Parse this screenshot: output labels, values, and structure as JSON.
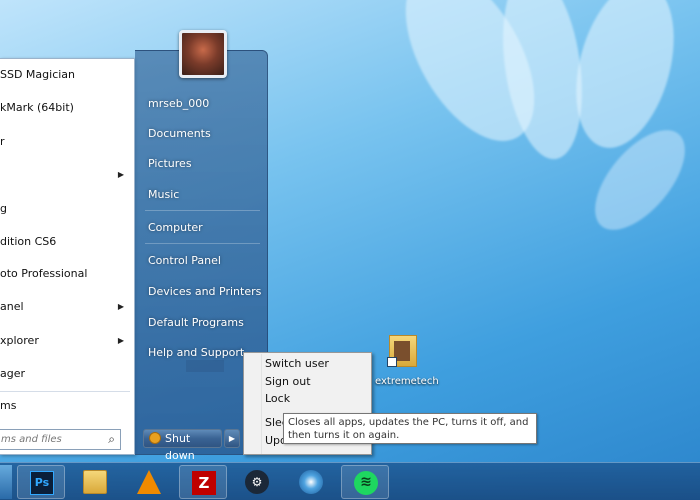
{
  "start_menu": {
    "programs": [
      {
        "label": "SSD Magician",
        "has_arrow": false
      },
      {
        "label": "kMark (64bit)",
        "has_arrow": false
      },
      {
        "label": "r",
        "has_arrow": false
      },
      {
        "label": "",
        "has_arrow": true
      },
      {
        "label": "g",
        "has_arrow": false
      },
      {
        "label": "dition CS6",
        "has_arrow": false
      },
      {
        "label": "oto Professional",
        "has_arrow": false
      },
      {
        "label": "anel",
        "has_arrow": true
      },
      {
        "label": "xplorer",
        "has_arrow": true
      },
      {
        "label": "ager",
        "has_arrow": false
      }
    ],
    "all_programs": "ms",
    "search_placeholder": "ms and files",
    "right_links": [
      "mrseb_000",
      "Documents",
      "Pictures",
      "Music",
      "Computer",
      "Control Panel",
      "Devices and Printers",
      "Default Programs",
      "Help and Support"
    ],
    "shutdown_label": "Shut down"
  },
  "context_menu": {
    "items": [
      "Switch user",
      "Sign out",
      "Lock",
      "Slee",
      "Upd"
    ]
  },
  "tooltip": {
    "text": "Closes all apps, updates the PC, turns it off, and then turns it on again."
  },
  "desktop": {
    "icon_label": "extremetech"
  },
  "taskbar": {
    "apps": [
      {
        "name": "photoshop-icon",
        "glyph": "Ps",
        "active": true
      },
      {
        "name": "file-explorer-icon",
        "glyph": "",
        "active": false
      },
      {
        "name": "vlc-icon",
        "glyph": "",
        "active": false
      },
      {
        "name": "filezilla-icon",
        "glyph": "Z",
        "active": true
      },
      {
        "name": "steam-icon",
        "glyph": "⚙",
        "active": false
      },
      {
        "name": "media-player-icon",
        "glyph": "",
        "active": false
      },
      {
        "name": "spotify-icon",
        "glyph": "≋",
        "active": true
      }
    ]
  }
}
